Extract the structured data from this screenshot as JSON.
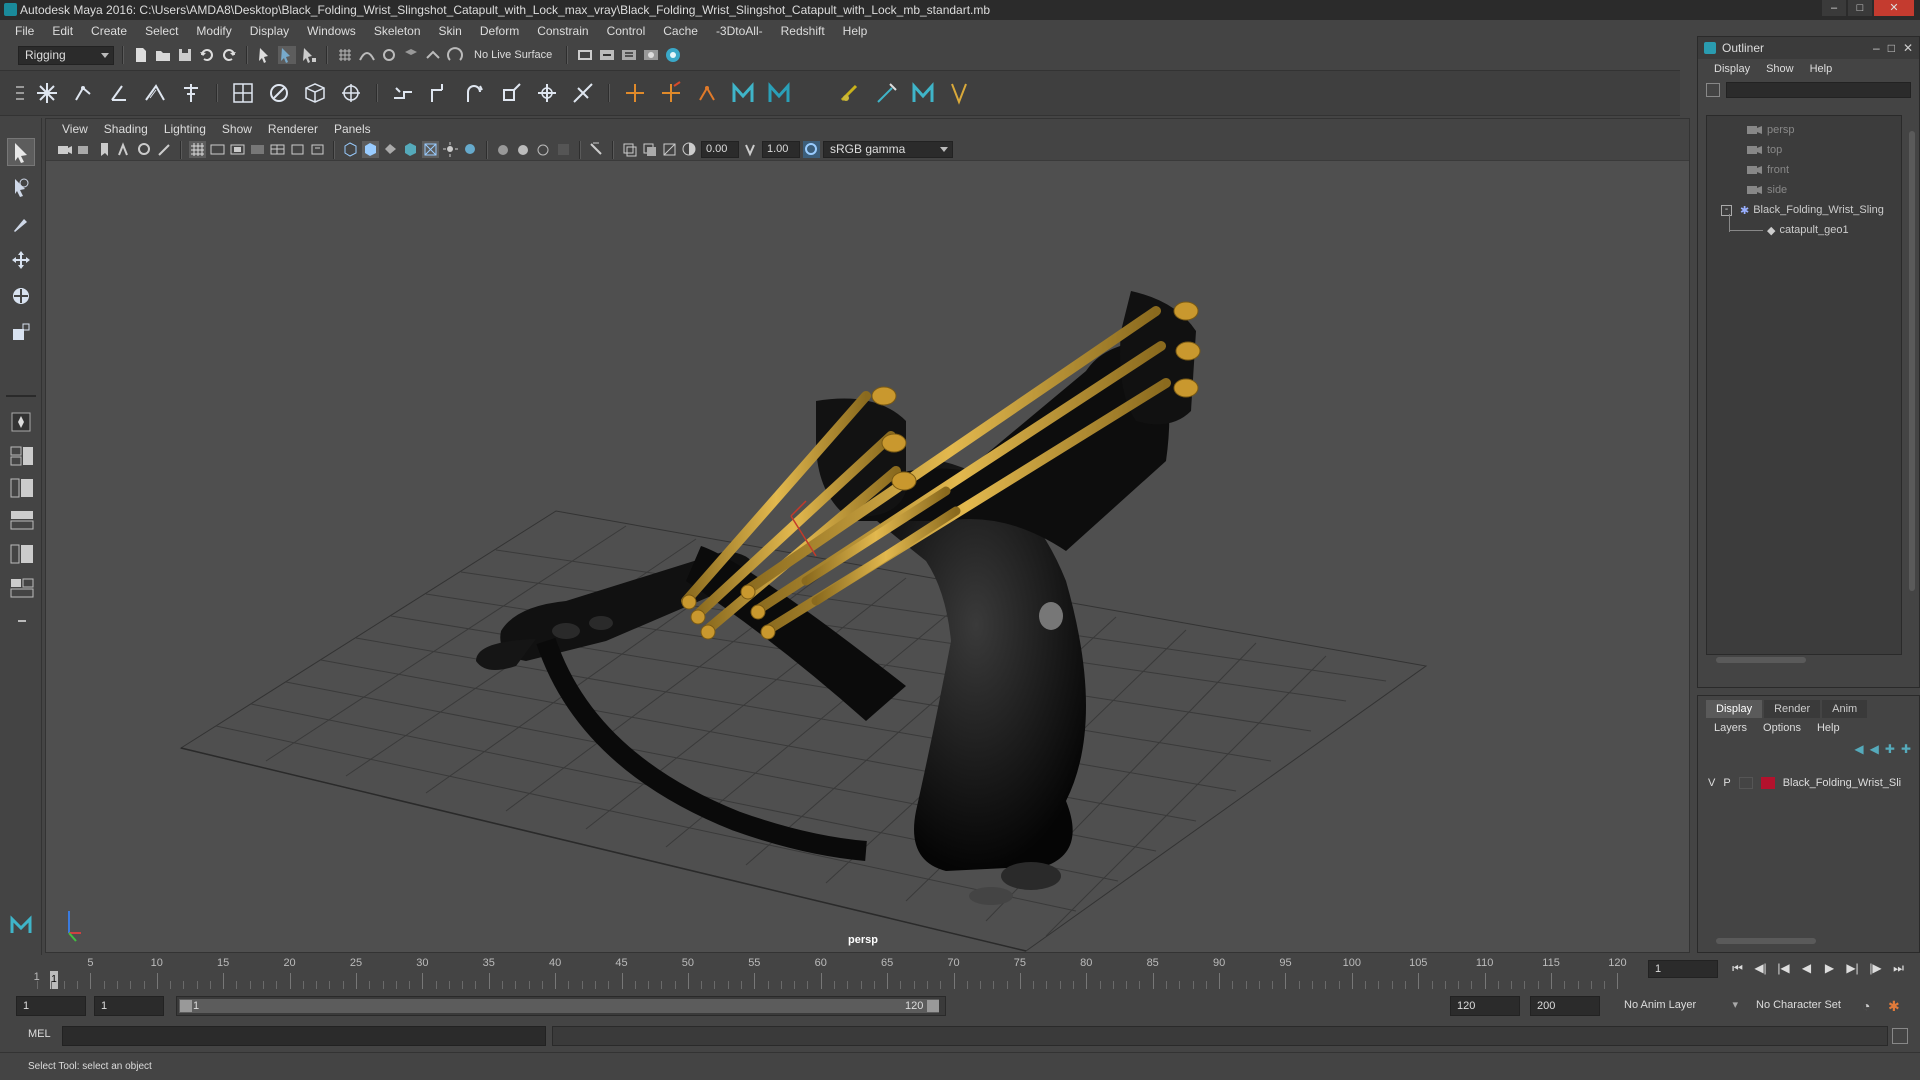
{
  "window": {
    "title": "Autodesk Maya 2016: C:\\Users\\AMDA8\\Desktop\\Black_Folding_Wrist_Slingshot_Catapult_with_Lock_max_vray\\Black_Folding_Wrist_Slingshot_Catapult_with_Lock_mb_standart.mb"
  },
  "menubar": [
    "File",
    "Edit",
    "Create",
    "Select",
    "Modify",
    "Display",
    "Windows",
    "Skeleton",
    "Skin",
    "Deform",
    "Constrain",
    "Control",
    "Cache",
    "-3DtoAll-",
    "Redshift",
    "Help"
  ],
  "statusline": {
    "mode": "Rigging",
    "live_surface": "No Live Surface"
  },
  "viewport": {
    "menu": [
      "View",
      "Shading",
      "Lighting",
      "Show",
      "Renderer",
      "Panels"
    ],
    "exposure": "0.00",
    "gamma": "1.00",
    "color_space": "sRGB gamma",
    "camera_label": "persp"
  },
  "outliner": {
    "title": "Outliner",
    "menu": [
      "Display",
      "Show",
      "Help"
    ],
    "items": [
      {
        "label": "persp",
        "type": "camera"
      },
      {
        "label": "top",
        "type": "camera"
      },
      {
        "label": "front",
        "type": "camera"
      },
      {
        "label": "side",
        "type": "camera"
      },
      {
        "label": "Black_Folding_Wrist_Sling",
        "type": "group"
      },
      {
        "label": "catapult_geo1",
        "type": "mesh"
      }
    ]
  },
  "layers": {
    "tabs": [
      "Display",
      "Render",
      "Anim"
    ],
    "active_tab": "Display",
    "menu": [
      "Layers",
      "Options",
      "Help"
    ],
    "row": {
      "v": "V",
      "p": "P",
      "name": "Black_Folding_Wrist_Sli",
      "color": "#b3122d"
    }
  },
  "timeslider": {
    "ticks": [
      "5",
      "10",
      "15",
      "20",
      "25",
      "30",
      "35",
      "40",
      "45",
      "50",
      "55",
      "60",
      "65",
      "70",
      "75",
      "80",
      "85",
      "90",
      "95",
      "100",
      "105",
      "110",
      "115",
      "120"
    ],
    "start_label": "1",
    "current_frame": "1"
  },
  "range": {
    "start": "1",
    "playback_start": "1",
    "slider_start": "1",
    "slider_end": "120",
    "playback_end": "120",
    "end": "200",
    "anim_layer": "No Anim Layer",
    "character_set": "No Character Set"
  },
  "commandline": {
    "lang": "MEL"
  },
  "help": {
    "text": "Select Tool: select an object"
  }
}
